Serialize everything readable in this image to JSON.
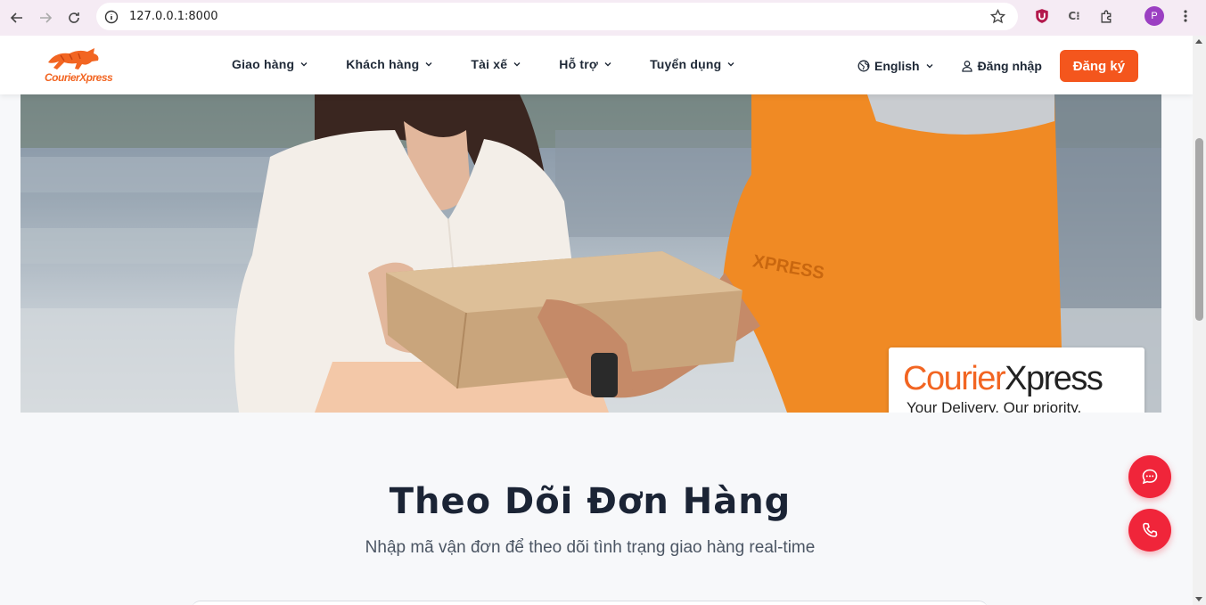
{
  "browser": {
    "url": "127.0.0.1:8000",
    "profile_initial": "P"
  },
  "header": {
    "logo_text": "CourierXpress",
    "nav": [
      {
        "label": "Giao hàng"
      },
      {
        "label": "Khách hàng"
      },
      {
        "label": "Tài xế"
      },
      {
        "label": "Hỗ trợ"
      },
      {
        "label": "Tuyển dụng"
      }
    ],
    "language": "English",
    "login": "Đăng nhập",
    "signup": "Đăng ký"
  },
  "hero": {
    "badge_brand_part1": "Courier",
    "badge_brand_part2": "Xpress",
    "badge_tagline": "Your Delivery, Our priority.",
    "sleeve_text": "XPRESS"
  },
  "tracking": {
    "title": "Theo Dõi Đơn Hàng",
    "subtitle": "Nhập mã vận đơn để theo dõi tình trạng giao hàng real-time"
  },
  "colors": {
    "brand_orange": "#f4561d",
    "fab_red": "#f0253a",
    "text_dark": "#1b2435"
  },
  "icons": {
    "fab_chat": "chat-bubble-icon",
    "fab_phone": "phone-icon"
  }
}
